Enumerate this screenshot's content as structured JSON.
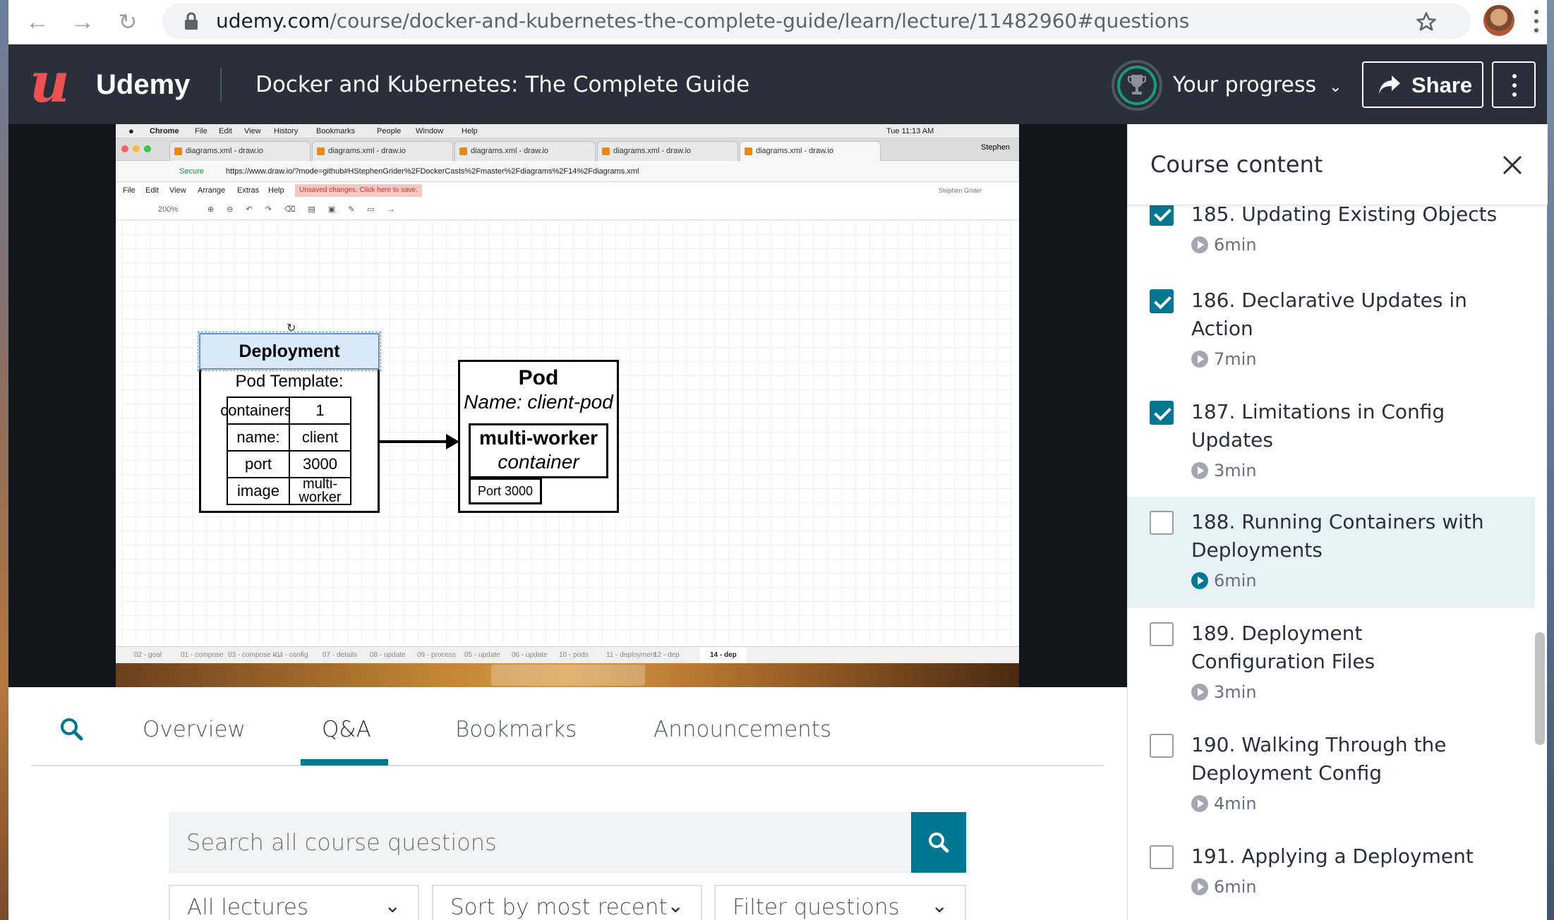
{
  "browser": {
    "url_domain": "udemy.com",
    "url_path": "/course/docker-and-kubernetes-the-complete-guide/learn/lecture/11482960#questions"
  },
  "header": {
    "brand": "Udemy",
    "course_title": "Docker and Kubernetes: The Complete Guide",
    "progress_label": "Your progress",
    "share_label": "Share"
  },
  "video": {
    "menubar": {
      "app": "Chrome",
      "items": [
        "File",
        "Edit",
        "View",
        "History",
        "Bookmarks",
        "People",
        "Window",
        "Help"
      ],
      "clock": "Tue 11:13 AM"
    },
    "tabs": [
      "diagrams.xml - draw.io",
      "diagrams.xml - draw.io",
      "diagrams.xml - draw.io",
      "diagrams.xml - draw.io",
      "diagrams.xml - draw.io"
    ],
    "profile": "Stephen",
    "address": {
      "secure": "Secure",
      "url": "https://www.draw.io/?mode=github#HStephenGrider%2FDockerCasts%2Fmaster%2Fdiagrams%2F14%2Fdiagrams.xml"
    },
    "drawio_menu": [
      "File",
      "Edit",
      "View",
      "Arrange",
      "Extras",
      "Help"
    ],
    "unsaved": "Unsaved changes. Click here to save.",
    "user": "Stephen Grider",
    "zoom": "200%",
    "pages": [
      "02 - goal",
      "01 - compose",
      "03 - compose k...",
      "04 - config",
      "07 - details",
      "08 - update",
      "09 - process",
      "05 - update",
      "06 - update",
      "10 - pods",
      "11 - deployment",
      "12 - dep",
      "14 - dep"
    ],
    "diagram": {
      "deployment_title": "Deployment",
      "pod_template": "Pod Template:",
      "table": [
        [
          "containers:",
          "1"
        ],
        [
          "name:",
          "client"
        ],
        [
          "port",
          "3000"
        ],
        [
          "image",
          "multi-\nworker"
        ]
      ],
      "pod_title": "Pod",
      "pod_name": "Name: client-pod",
      "container_title": "multi-worker",
      "container_sub": "container",
      "port_label": "Port 3000"
    }
  },
  "tabs": {
    "items": [
      "Overview",
      "Q&A",
      "Bookmarks",
      "Announcements"
    ],
    "active": "Q&A"
  },
  "qa": {
    "search_placeholder": "Search all course questions",
    "filters": [
      "All lectures",
      "Sort by most recent",
      "Filter questions"
    ]
  },
  "sidebar": {
    "title": "Course content",
    "lectures": [
      {
        "title": "185. Updating Existing Objects",
        "duration": "6min",
        "done": true
      },
      {
        "title": "186. Declarative Updates in Action",
        "duration": "7min",
        "done": true
      },
      {
        "title": "187. Limitations in Config Updates",
        "duration": "3min",
        "done": true
      },
      {
        "title": "188. Running Containers with Deployments",
        "duration": "6min",
        "done": false,
        "current": true
      },
      {
        "title": "189. Deployment Configuration Files",
        "duration": "3min",
        "done": false
      },
      {
        "title": "190. Walking Through the Deployment Config",
        "duration": "4min",
        "done": false
      },
      {
        "title": "191. Applying a Deployment",
        "duration": "6min",
        "done": false
      }
    ]
  },
  "colors": {
    "accent": "#007791",
    "brand_red": "#ec5252",
    "header_bg": "#29303b"
  }
}
